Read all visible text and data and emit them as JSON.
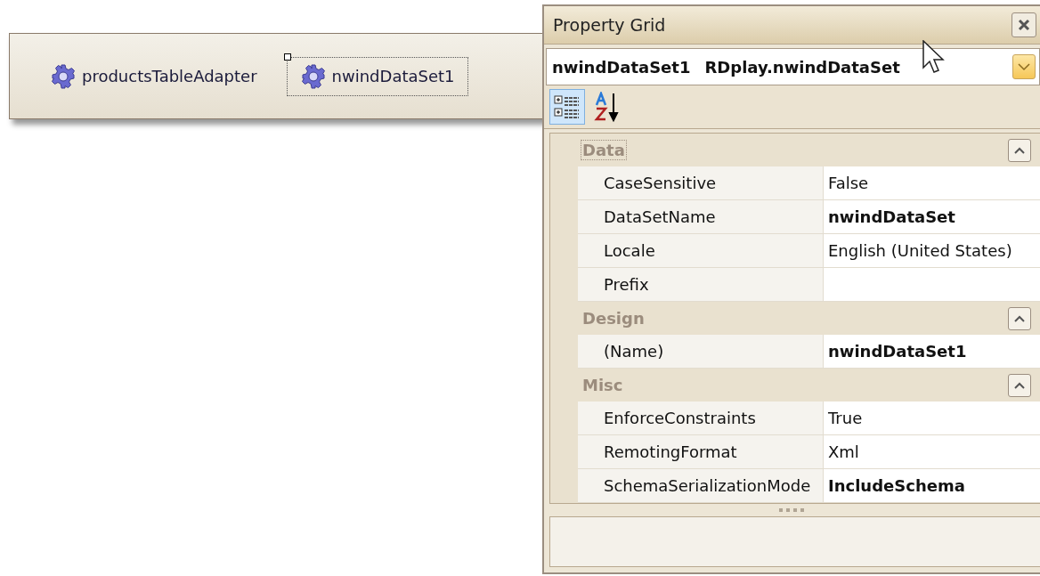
{
  "tray": {
    "items": [
      {
        "label": "productsTableAdapter",
        "selected": false
      },
      {
        "label": "nwindDataSet1",
        "selected": true
      }
    ]
  },
  "property_grid": {
    "title": "Property Grid",
    "object_selector": {
      "name": "nwindDataSet1",
      "type": "RDplay.nwindDataSet"
    },
    "toolbar": [
      {
        "kind": "categorized",
        "selected": true
      },
      {
        "kind": "alphabetical",
        "selected": false
      }
    ],
    "categories": [
      {
        "name": "Data",
        "focused": true,
        "expanded": true,
        "properties": [
          {
            "name": "CaseSensitive",
            "value": "False",
            "bold": false
          },
          {
            "name": "DataSetName",
            "value": "nwindDataSet",
            "bold": true
          },
          {
            "name": "Locale",
            "value": "English (United States)",
            "bold": false
          },
          {
            "name": "Prefix",
            "bold": false
          }
        ]
      },
      {
        "name": "Design",
        "focused": false,
        "expanded": true,
        "properties": [
          {
            "name": "(Name)",
            "value": "nwindDataSet1",
            "bold": true
          }
        ]
      },
      {
        "name": "Misc",
        "focused": false,
        "expanded": true,
        "properties": [
          {
            "name": "EnforceConstraints",
            "value": "True",
            "bold": false
          },
          {
            "name": "RemotingFormat",
            "value": "Xml",
            "bold": false
          },
          {
            "name": "SchemaSerializationMode",
            "value": "IncludeSchema",
            "bold": true
          }
        ]
      }
    ]
  }
}
